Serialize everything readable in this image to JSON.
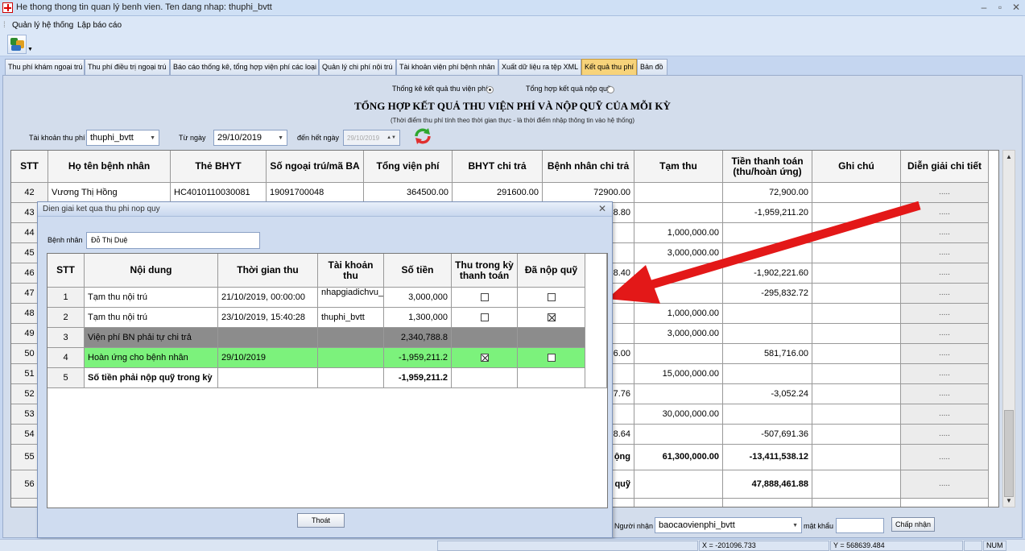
{
  "window": {
    "title": "He thong thong tin quan lý benh vien. Ten dang nhap: thuphi_bvtt"
  },
  "menu": [
    "Quản lý hệ thống",
    "Lập báo cáo"
  ],
  "tabs": [
    "Thu phí khám ngoại trú",
    "Thu phí điều trị ngoại trú",
    "Báo cáo thống kê, tổng hợp viện phí các loại",
    "Quản lý chi phí nội trú",
    "Tài khoản viện phí bệnh nhân",
    "Xuất dữ liệu ra tệp XML",
    "Kết quả thu phí",
    "Bản đồ"
  ],
  "options": {
    "opt1": "Thống kê kết quả thu viện phí",
    "opt2": "Tổng hợp kết quả nộp quỹ",
    "selected": "opt1"
  },
  "heading": {
    "title": "TỔNG HỢP KẾT QUẢ THU VIỆN PHÍ VÀ NỘP QUỸ CỦA MỖI KỲ",
    "subtitle": "(Thời điểm thu phí tính theo thời gian thực - là thời điểm nhập thông tin vào hệ thống)"
  },
  "filters": {
    "account_label": "Tài khoản thu phí",
    "account_value": "thuphi_bvtt",
    "from_label": "Từ ngày",
    "from_value": "29/10/2019",
    "to_label": "đến hết ngày",
    "to_value": "29/10/2019"
  },
  "grid": {
    "headers": [
      "STT",
      "Họ tên bệnh nhân",
      "Thẻ BHYT",
      "Số ngoại trú/mã BA",
      "Tổng viện phí",
      "BHYT chi trả",
      "Bệnh nhân chi trả",
      "Tạm thu",
      "Tiền thanh toán (thu/hoàn ứng)",
      "Ghi chú",
      "Diễn giải chi tiết"
    ],
    "rows": [
      {
        "stt": "42",
        "name": "Vương Thị Hồng",
        "bhyt": "HC4010110030081",
        "so": "19091700048",
        "tong": "364500.00",
        "bhyt_tra": "291600.00",
        "bn_tra": "72900.00",
        "tamthu": "",
        "tt": "72,900.00",
        "detail": "....."
      },
      {
        "stt": "43",
        "name": "",
        "bhyt": "",
        "so": "",
        "tong": "",
        "bhyt_tra": "",
        "bn_tra": "8.80",
        "tamthu": "",
        "tt": "-1,959,211.20",
        "detail": "....."
      },
      {
        "stt": "44",
        "name": "",
        "bhyt": "",
        "so": "",
        "tong": "",
        "bhyt_tra": "",
        "bn_tra": "",
        "tamthu": "1,000,000.00",
        "tt": "",
        "detail": "....."
      },
      {
        "stt": "45",
        "name": "",
        "bhyt": "",
        "so": "",
        "tong": "",
        "bhyt_tra": "",
        "bn_tra": "",
        "tamthu": "3,000,000.00",
        "tt": "",
        "detail": "....."
      },
      {
        "stt": "46",
        "name": "",
        "bhyt": "",
        "so": "",
        "tong": "",
        "bhyt_tra": "",
        "bn_tra": "8.40",
        "tamthu": "",
        "tt": "-1,902,221.60",
        "detail": "....."
      },
      {
        "stt": "47",
        "name": "",
        "bhyt": "",
        "so": "",
        "tong": "",
        "bhyt_tra": "",
        "bn_tra": "",
        "tamthu": "",
        "tt": "-295,832.72",
        "detail": "....."
      },
      {
        "stt": "48",
        "name": "",
        "bhyt": "",
        "so": "",
        "tong": "",
        "bhyt_tra": "",
        "bn_tra": "",
        "tamthu": "1,000,000.00",
        "tt": "",
        "detail": "....."
      },
      {
        "stt": "49",
        "name": "",
        "bhyt": "",
        "so": "",
        "tong": "",
        "bhyt_tra": "",
        "bn_tra": "",
        "tamthu": "3,000,000.00",
        "tt": "",
        "detail": "....."
      },
      {
        "stt": "50",
        "name": "",
        "bhyt": "",
        "so": "",
        "tong": "",
        "bhyt_tra": "",
        "bn_tra": "6.00",
        "tamthu": "",
        "tt": "581,716.00",
        "detail": "....."
      },
      {
        "stt": "51",
        "name": "",
        "bhyt": "",
        "so": "",
        "tong": "",
        "bhyt_tra": "",
        "bn_tra": "",
        "tamthu": "15,000,000.00",
        "tt": "",
        "detail": "....."
      },
      {
        "stt": "52",
        "name": "",
        "bhyt": "",
        "so": "",
        "tong": "",
        "bhyt_tra": "",
        "bn_tra": "7.76",
        "tamthu": "",
        "tt": "-3,052.24",
        "detail": "....."
      },
      {
        "stt": "53",
        "name": "",
        "bhyt": "",
        "so": "",
        "tong": "",
        "bhyt_tra": "",
        "bn_tra": "",
        "tamthu": "30,000,000.00",
        "tt": "",
        "detail": "....."
      },
      {
        "stt": "54",
        "name": "",
        "bhyt": "",
        "so": "",
        "tong": "",
        "bhyt_tra": "",
        "bn_tra": "8.64",
        "tamthu": "",
        "tt": "-507,691.36",
        "detail": "....."
      },
      {
        "stt": "55",
        "name": "",
        "bhyt": "",
        "so": "",
        "tong": "",
        "bhyt_tra": "",
        "bn_tra": "ộng",
        "tamthu": "61,300,000.00",
        "tt": "-13,411,538.12",
        "detail": "....."
      },
      {
        "stt": "56",
        "name": "",
        "bhyt": "",
        "so": "",
        "tong": "",
        "bhyt_tra": "",
        "bn_tra": "quỹ",
        "tamthu": "",
        "tt": "47,888,461.88",
        "detail": "....."
      }
    ]
  },
  "dialog": {
    "title": "Dien giai ket qua thu phi nop quy",
    "patient_label": "Bệnh nhân",
    "patient_value": "Đỗ Thị Duệ",
    "headers": [
      "STT",
      "Nội dung",
      "Thời gian thu",
      "Tài khoản thu",
      "Số tiền",
      "Thu trong kỳ thanh toán",
      "Đã nộp quỹ"
    ],
    "rows": [
      {
        "stt": "1",
        "nd": "Tạm thu nội trú",
        "tg": "21/10/2019, 00:00:00",
        "tk": "nhapgiadichvu_bvtt",
        "st": "3,000,000",
        "c1": "",
        "c2": ""
      },
      {
        "stt": "2",
        "nd": "Tạm thu nội trú",
        "tg": "23/10/2019, 15:40:28",
        "tk": "thuphi_bvtt",
        "st": "1,300,000",
        "c1": "",
        "c2": "x"
      },
      {
        "stt": "3",
        "nd": "Viện phí BN phải tự chi trả",
        "tg": "",
        "tk": "",
        "st": "2,340,788.8",
        "c1": null,
        "c2": null
      },
      {
        "stt": "4",
        "nd": "Hoàn ứng cho bệnh nhân",
        "tg": "29/10/2019",
        "tk": "",
        "st": "-1,959,211.2",
        "c1": "x",
        "c2": ""
      },
      {
        "stt": "5",
        "nd": "Số tiền phải nộp quỹ trong kỳ",
        "tg": "",
        "tk": "",
        "st": "-1,959,211.2",
        "c1": null,
        "c2": null
      }
    ],
    "close_button": "Thoát"
  },
  "bottom": {
    "receiver_label": "Người nhận tiền",
    "receiver_value": "baocaovienphi_bvtt",
    "password_label": "mật khẩu",
    "accept_button": "Chấp nhận"
  },
  "status": {
    "x": "X = -201096.733",
    "y": "Y = 568639.484",
    "num": "NUM"
  },
  "colors": {
    "active_tab": "#f7d37a",
    "green_row": "#7cf27c",
    "gray_row": "#8c8c8c",
    "arrow": "#e31818"
  }
}
